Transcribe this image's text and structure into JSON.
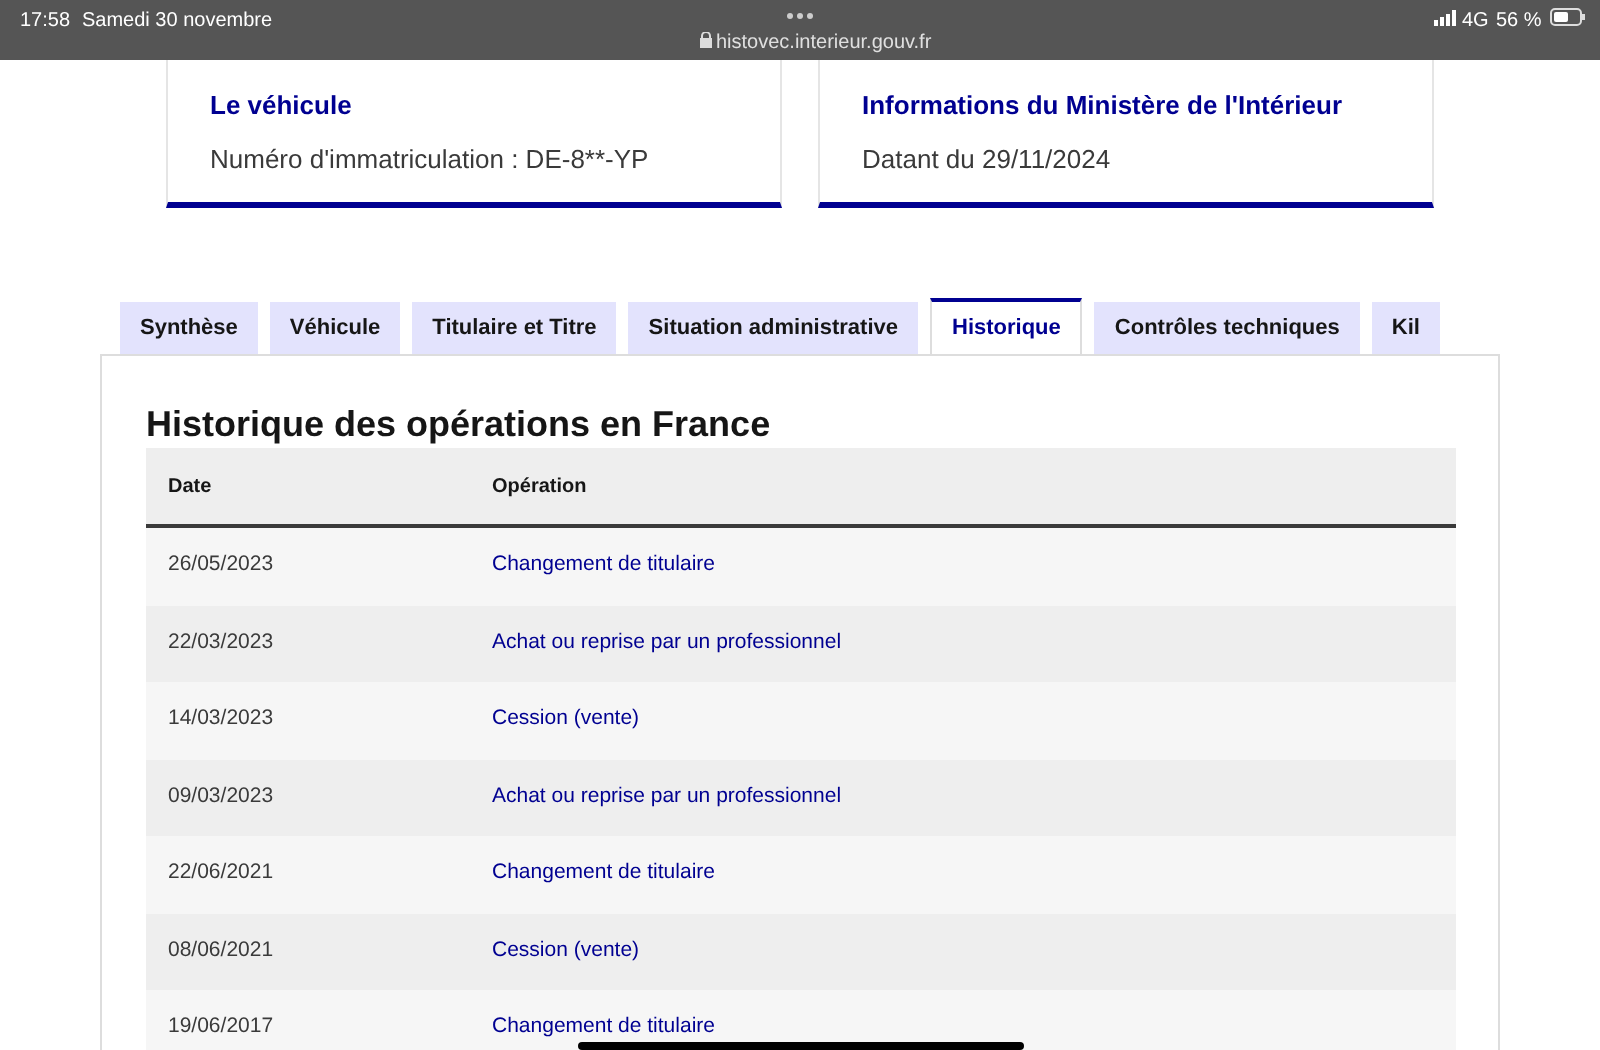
{
  "status_bar": {
    "time": "17:58",
    "date": "Samedi 30 novembre",
    "url": "histovec.interieur.gouv.fr",
    "network": "4G",
    "battery": "56 %"
  },
  "cards": [
    {
      "title": "Le véhicule",
      "text": "Numéro d'immatriculation : DE-8**-YP"
    },
    {
      "title": "Informations du Ministère de l'Intérieur",
      "text": "Datant du 29/11/2024"
    }
  ],
  "tabs": [
    {
      "label": "Synthèse",
      "selected": false
    },
    {
      "label": "Véhicule",
      "selected": false
    },
    {
      "label": "Titulaire et Titre",
      "selected": false
    },
    {
      "label": "Situation administrative",
      "selected": false
    },
    {
      "label": "Historique",
      "selected": true
    },
    {
      "label": "Contrôles techniques",
      "selected": false
    },
    {
      "label": "Kil",
      "selected": false
    }
  ],
  "section_title": "Historique des opérations en France",
  "table": {
    "columns": [
      "Date",
      "Opération"
    ],
    "rows": [
      [
        "26/05/2023",
        "Changement de titulaire"
      ],
      [
        "22/03/2023",
        "Achat ou reprise par un professionnel"
      ],
      [
        "14/03/2023",
        "Cession (vente)"
      ],
      [
        "09/03/2023",
        "Achat ou reprise par un professionnel"
      ],
      [
        "22/06/2021",
        "Changement de titulaire"
      ],
      [
        "08/06/2021",
        "Cession (vente)"
      ],
      [
        "19/06/2017",
        "Changement de titulaire"
      ]
    ]
  }
}
